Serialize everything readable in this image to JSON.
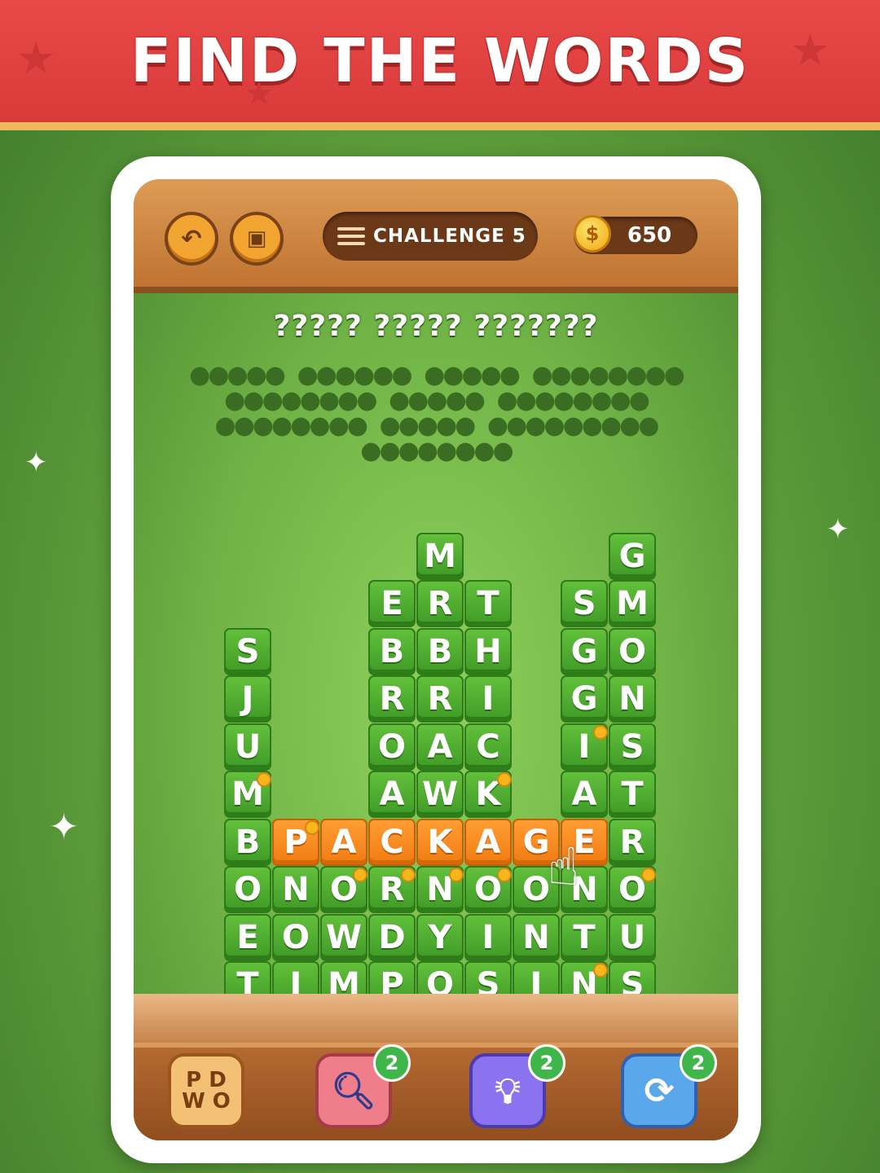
{
  "banner": {
    "title": "FIND THE WORDS"
  },
  "header": {
    "back_icon": "back-arrow-icon",
    "picture_icon": "picture-icon",
    "challenge_label": "CHALLENGE 5",
    "coins": "650",
    "coin_symbol": "$"
  },
  "clue": {
    "title": "????? ????? ???????",
    "text": "●●●●● ●●●●●● ●●●●● ●●●●●●●● ●●●●●●●● ●●●●● ●●●●●●●● ●●●●●●●● ●●●●● ●●●●●●●●● ●●●●●●●●"
  },
  "board": {
    "columns": [
      {
        "col": 0,
        "letters": [
          "S",
          "J",
          "U",
          "M",
          "B",
          "O",
          "E",
          "T"
        ]
      },
      {
        "col": 1,
        "letters": [
          "P",
          "N",
          "O",
          "I"
        ]
      },
      {
        "col": 2,
        "letters": [
          "A",
          "O",
          "W",
          "M"
        ]
      },
      {
        "col": 3,
        "letters": [
          "E",
          "B",
          "R",
          "O",
          "A",
          "C",
          "R",
          "D",
          "P"
        ]
      },
      {
        "col": 4,
        "letters": [
          "M",
          "R",
          "B",
          "R",
          "A",
          "W",
          "K",
          "N",
          "Y",
          "O"
        ]
      },
      {
        "col": 5,
        "letters": [
          "T",
          "H",
          "I",
          "C",
          "K",
          "A",
          "O",
          "I",
          "S"
        ]
      },
      {
        "col": 6,
        "letters": [
          "G",
          "O",
          "N",
          "I"
        ]
      },
      {
        "col": 7,
        "letters": [
          "S",
          "G",
          "G",
          "I",
          "A",
          "E",
          "N",
          "T",
          "N"
        ]
      },
      {
        "col": 8,
        "letters": [
          "G",
          "M",
          "O",
          "N",
          "S",
          "T",
          "R",
          "O",
          "U",
          "S"
        ]
      }
    ],
    "selected_word": "PACKAGE"
  },
  "tools": {
    "words_label": [
      "P D",
      "W O"
    ],
    "search_count": "2",
    "hint_count": "2",
    "shuffle_count": "2",
    "search_icon": "magnifier-icon",
    "hint_icon": "lightbulb-icon",
    "shuffle_icon": "refresh-icon"
  },
  "colors": {
    "tile": "#4caf30",
    "selected_tile": "#f5891e",
    "banner": "#e24544"
  }
}
